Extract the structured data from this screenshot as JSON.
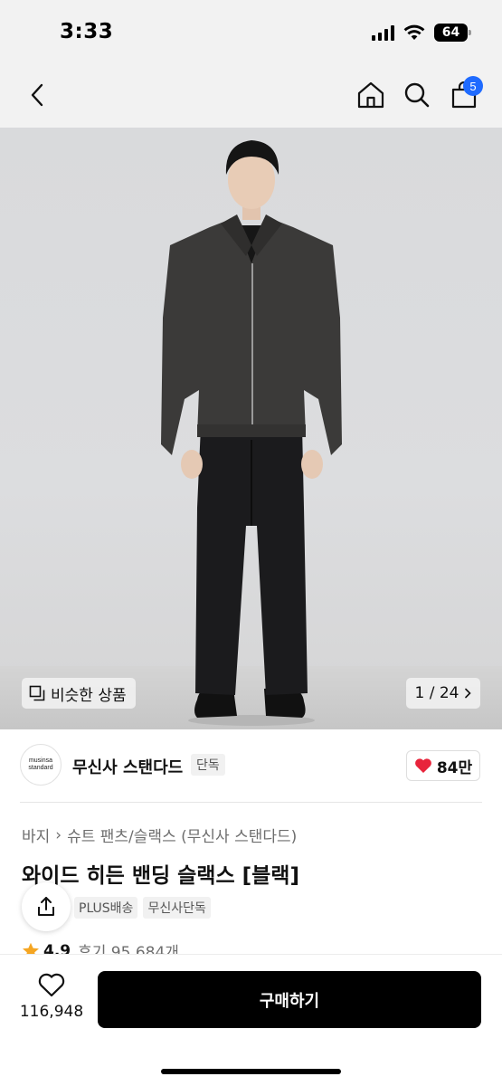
{
  "status_bar": {
    "time": "3:33",
    "battery": "64"
  },
  "nav": {
    "cart_count": "5"
  },
  "gallery": {
    "similar_label": "비슷한 상품",
    "pager": "1 / 24"
  },
  "brand": {
    "logo_line1": "musinsa",
    "logo_line2": "standard",
    "name": "무신사 스탠다드",
    "exclusive": "단독",
    "likes": "84만"
  },
  "product": {
    "breadcrumb": [
      "바지",
      "슈트 팬츠/슬랙스 (무신사 스탠다드)"
    ],
    "title": "와이드 히든 밴딩 슬랙스 [블랙]",
    "tags": [
      "PLUS배송",
      "무신사단독"
    ],
    "rating": "4.9",
    "review_label": "후기 95,684개"
  },
  "bottom": {
    "wish_count": "116,948",
    "buy_label": "구매하기"
  },
  "colors": {
    "accent": "#1f6bff",
    "heart": "#e8243b",
    "star": "#f5a623",
    "buy_bg": "#000000"
  }
}
